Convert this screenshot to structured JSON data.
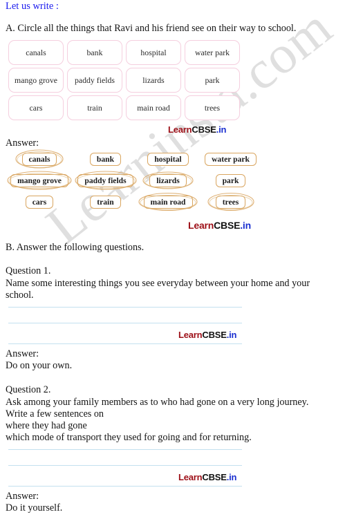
{
  "header": {
    "title": "Let us write :",
    "title_color": "#1a1aee"
  },
  "sectionA": {
    "instruction": "A. Circle all the things that Ravi and his friend see on their way to school.",
    "word_grid": {
      "columns": 4,
      "cells": [
        "canals",
        "bank",
        "hospital",
        "water park",
        "mango grove",
        "paddy fields",
        "lizards",
        "park",
        "cars",
        "train",
        "main road",
        "trees"
      ]
    },
    "answer_label": "Answer:",
    "answer_grid": {
      "columns": 4,
      "cells": [
        {
          "label": "canals",
          "circled": true
        },
        {
          "label": "bank",
          "circled": false
        },
        {
          "label": "hospital",
          "circled": false
        },
        {
          "label": "water park",
          "circled": false
        },
        {
          "label": "mango grove",
          "circled": true
        },
        {
          "label": "paddy fields",
          "circled": true
        },
        {
          "label": "lizards",
          "circled": true
        },
        {
          "label": "park",
          "circled": false
        },
        {
          "label": "cars",
          "circled": false
        },
        {
          "label": "train",
          "circled": false
        },
        {
          "label": "main road",
          "circled": true
        },
        {
          "label": "trees",
          "circled": true
        }
      ]
    }
  },
  "sectionB": {
    "instruction": "B. Answer the following questions.",
    "questions": [
      {
        "number": "Question 1.",
        "text_line1": "Name some interesting things you see everyday between your home and your",
        "text_line2": "school.",
        "answer_label": "Answer:",
        "answer_text": "Do on your own."
      },
      {
        "number": "Question 2.",
        "text_line1": "Ask among your family members as to who had gone on a very long journey.",
        "text_line2": "Write a few sentences on",
        "text_line3": "where they had gone",
        "text_line4": "which mode of transport they used for going and for returning.",
        "answer_label": "Answer:",
        "answer_text": "Do it yourself."
      }
    ]
  },
  "branding": {
    "logo_part1": "Learn",
    "logo_part2": "CBSE",
    "logo_part3": ".in",
    "watermark": "Learninsta.com",
    "colors": {
      "learn": "#9d0f17",
      "cbse": "#111111",
      "in": "#1a2fd0",
      "pink_border": "#f5cede",
      "tan_border": "#d9a55f",
      "rule_blue": "#c3e0ef"
    }
  }
}
